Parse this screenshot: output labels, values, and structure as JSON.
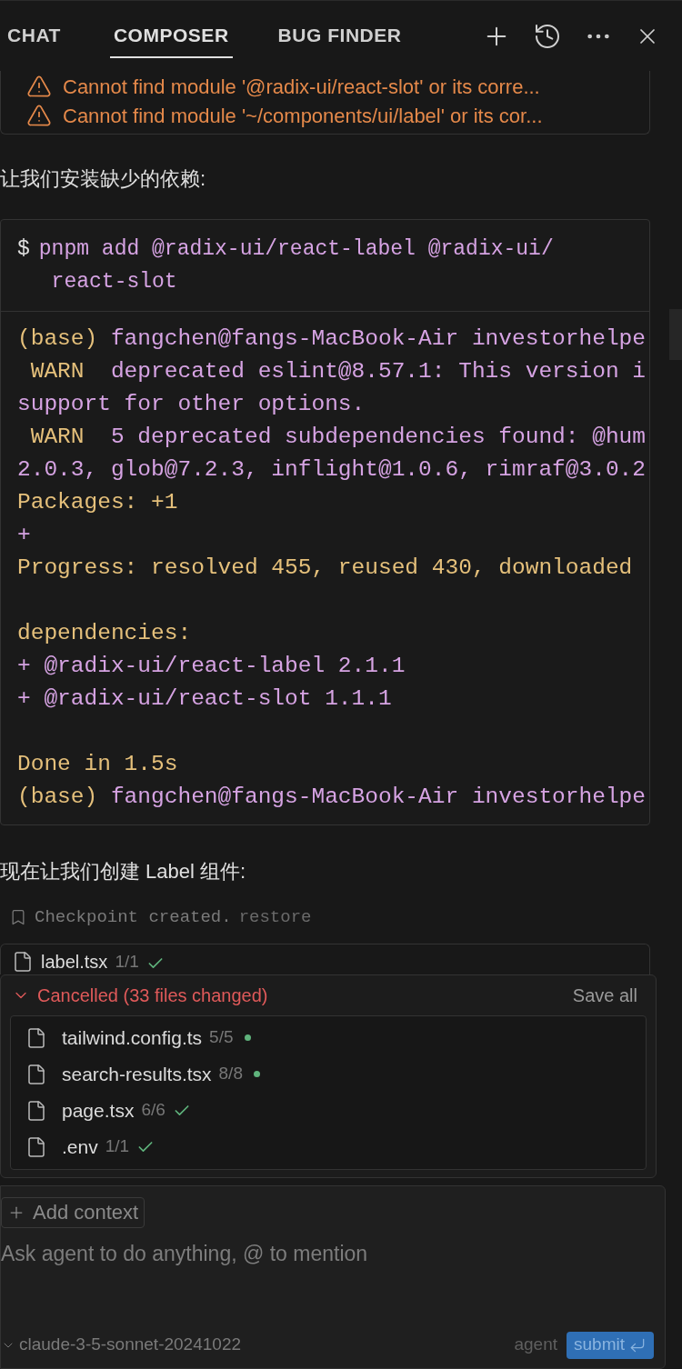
{
  "tabs": [
    {
      "label": "CHAT",
      "selected": false
    },
    {
      "label": "COMPOSER",
      "selected": true
    },
    {
      "label": "BUG FINDER",
      "selected": false
    }
  ],
  "errors": [
    "Cannot find module '@radix-ui/react-slot' or its corre...",
    "Cannot find module '~/components/ui/label' or its cor..."
  ],
  "intro_text": "让我们安装缺少的依赖:",
  "command": {
    "prompt": "$",
    "text": "pnpm add @radix-ui/react-label @radix-ui/\n react-slot"
  },
  "terminal_lines": [
    [
      {
        "text": "(base) ",
        "color": "#e5c07b"
      },
      {
        "text": "fangchen@fangs-MacBook-Air investorhelpe",
        "color": "#d6a3e3"
      }
    ],
    [
      {
        "text": " WARN ",
        "color": "#e5c07b"
      },
      {
        "text": " deprecated eslint@8.57.1: This version i",
        "color": "#d6a3e3"
      }
    ],
    [
      {
        "text": "support for other options.",
        "color": "#d6a3e3"
      }
    ],
    [
      {
        "text": " WARN ",
        "color": "#e5c07b"
      },
      {
        "text": " 5 deprecated subdependencies found: @hum",
        "color": "#d6a3e3"
      }
    ],
    [
      {
        "text": "2.0.3, glob@7.2.3, inflight@1.0.6, rimraf@3.0.2",
        "color": "#d6a3e3"
      }
    ],
    [
      {
        "text": "Packages: +1",
        "color": "#e5c07b"
      }
    ],
    [
      {
        "text": "+",
        "color": "#d6a3e3"
      }
    ],
    [
      {
        "text": "Progress: resolved 455, reused 430, downloaded",
        "color": "#e5c07b"
      }
    ],
    {
      "kind": "blank"
    },
    [
      {
        "text": "dependencies:",
        "color": "#e5c07b"
      }
    ],
    [
      {
        "text": "+ @radix-ui/react-label 2.1.1",
        "color": "#d6a3e3"
      }
    ],
    [
      {
        "text": "+ @radix-ui/react-slot 1.1.1",
        "color": "#d6a3e3"
      }
    ],
    {
      "kind": "blank"
    },
    [
      {
        "text": "Done in 1.5s",
        "color": "#e5c07b"
      }
    ],
    [
      {
        "text": "(base) ",
        "color": "#e5c07b"
      },
      {
        "text": "fangchen@fangs-MacBook-Air investorhelpe",
        "color": "#d6a3e3"
      }
    ]
  ],
  "second_text": "现在让我们创建 Label 组件:",
  "checkpoint": {
    "text": "Checkpoint created.",
    "action": "restore"
  },
  "current_file": {
    "name": "label.tsx",
    "count": "1/1",
    "kind": "check"
  },
  "changes_panel": {
    "expanded": true,
    "title": "Cancelled (33 files changed)",
    "action": "Save all",
    "files": [
      {
        "name": "tailwind.config.ts",
        "count": "5/5",
        "kind": "dot"
      },
      {
        "name": "search-results.tsx",
        "count": "8/8",
        "kind": "dot"
      },
      {
        "name": "page.tsx",
        "count": "6/6",
        "kind": "check"
      },
      {
        "name": ".env",
        "count": "1/1",
        "kind": "check"
      }
    ]
  },
  "composer": {
    "add_context": "Add context",
    "placeholder": "Ask agent to do anything, @ to mention",
    "model": "claude-3-5-sonnet-20241022",
    "mode": "agent",
    "submit": "submit"
  }
}
